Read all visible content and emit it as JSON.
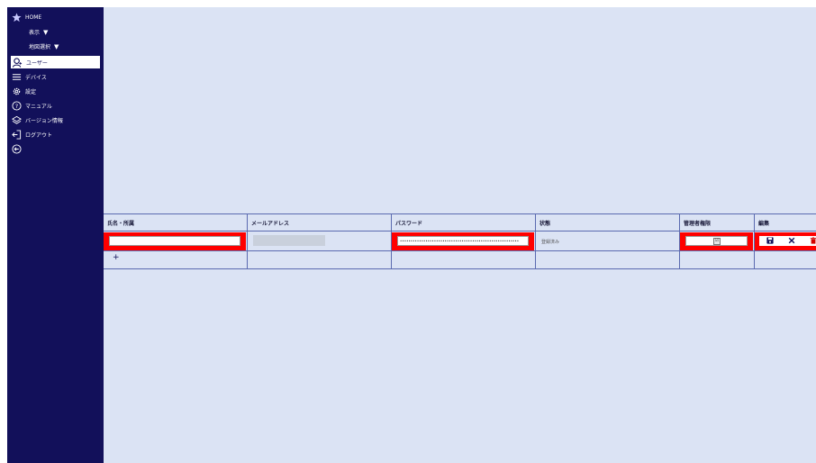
{
  "sidebar": {
    "home_label": "HOME",
    "view_label": "表示",
    "map_select_label": "地図選択",
    "dropdown_arrow": "▼",
    "items": [
      {
        "label": "ユーザー",
        "icon": "user-icon",
        "active": true
      },
      {
        "label": "デバイス",
        "icon": "list-icon",
        "active": false
      },
      {
        "label": "設定",
        "icon": "gear-icon",
        "active": false
      },
      {
        "label": "マニュアル",
        "icon": "help-icon",
        "active": false
      },
      {
        "label": "バージョン情報",
        "icon": "layers-icon",
        "active": false
      },
      {
        "label": "ログアウト",
        "icon": "logout-icon",
        "active": false
      }
    ],
    "collapse_icon": "back-arrow-icon"
  },
  "table": {
    "headers": [
      "氏名・所属",
      "メールアドレス",
      "パスワード",
      "状態",
      "管理者権限",
      "編集"
    ],
    "row": {
      "name_value": "",
      "email_value": "",
      "password_value": "••••••••••••••••••••••••••••••••••••••••••••••••••••••••",
      "status": "登録済み",
      "admin_checked": true,
      "checkbox_mark": "☑",
      "edit_actions": [
        "save-icon",
        "close-icon",
        "trash-icon"
      ]
    },
    "add_row_label": "+"
  },
  "colors": {
    "sidebar_bg": "#12105a",
    "main_bg": "#dbe3f4",
    "highlight": "#ff0000"
  }
}
